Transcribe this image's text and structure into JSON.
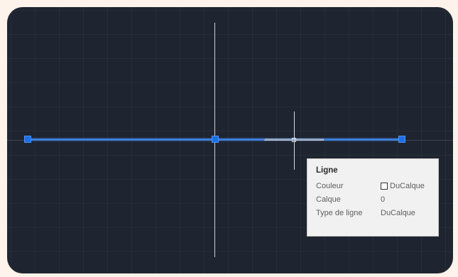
{
  "canvas": {
    "background": "#1f2530",
    "line_color": "#3d7fd9",
    "grip_color": "#1d6fe6"
  },
  "tooltip": {
    "title": "Ligne",
    "rows": [
      {
        "key": "Couleur",
        "value": "DuCalque",
        "swatch": true
      },
      {
        "key": "Calque",
        "value": "0"
      },
      {
        "key": "Type de ligne",
        "value": "DuCalque"
      }
    ]
  }
}
